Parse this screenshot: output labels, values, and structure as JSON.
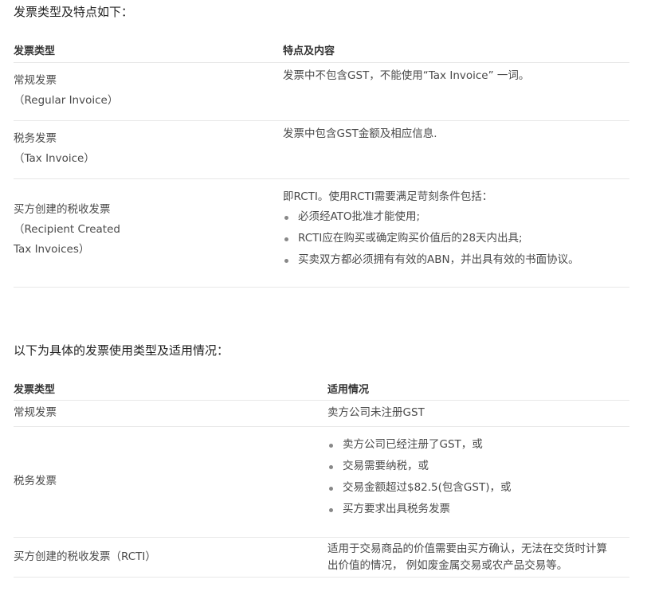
{
  "section1": {
    "heading": "发票类型及特点如下：",
    "headers": {
      "type": "发票类型",
      "features": "特点及内容"
    },
    "rows": [
      {
        "type_lines": [
          "常规发票",
          "（Regular Invoice）"
        ],
        "desc": "发票中不包含GST，不能使用“Tax Invoice” 一词。"
      },
      {
        "type_lines": [
          "税务发票",
          "（Tax Invoice）"
        ],
        "desc": "发票中包含GST金额及相应信息."
      },
      {
        "type_lines": [
          "买方创建的税收发票",
          "（Recipient Created",
          "Tax Invoices）"
        ],
        "desc": "即RCTI。使用RCTI需要满足苛刻条件包括：",
        "bullets": [
          "必须经ATO批准才能使用;",
          "RCTI应在购买或确定购买价值后的28天内出具;",
          "买卖双方都必须拥有有效的ABN，并出具有效的书面协议。"
        ]
      }
    ]
  },
  "section2": {
    "heading": "以下为具体的发票使用类型及适用情况：",
    "headers": {
      "type": "发票类型",
      "usage": "适用情况"
    },
    "rows": [
      {
        "type": "常规发票",
        "usage": "卖方公司未注册GST"
      },
      {
        "type": "税务发票",
        "bullets": [
          "卖方公司已经注册了GST，或",
          "交易需要纳税，或",
          "交易金额超过$82.5(包含GST)，或",
          "买方要求出具税务发票"
        ]
      },
      {
        "type": "买方创建的税收发票（RCTI）",
        "usage_lines": [
          "适用于交易商品的价值需要由买方确认，无法在交货时计算",
          "出价值的情况， 例如废金属交易或农产品交易等。"
        ]
      }
    ]
  }
}
